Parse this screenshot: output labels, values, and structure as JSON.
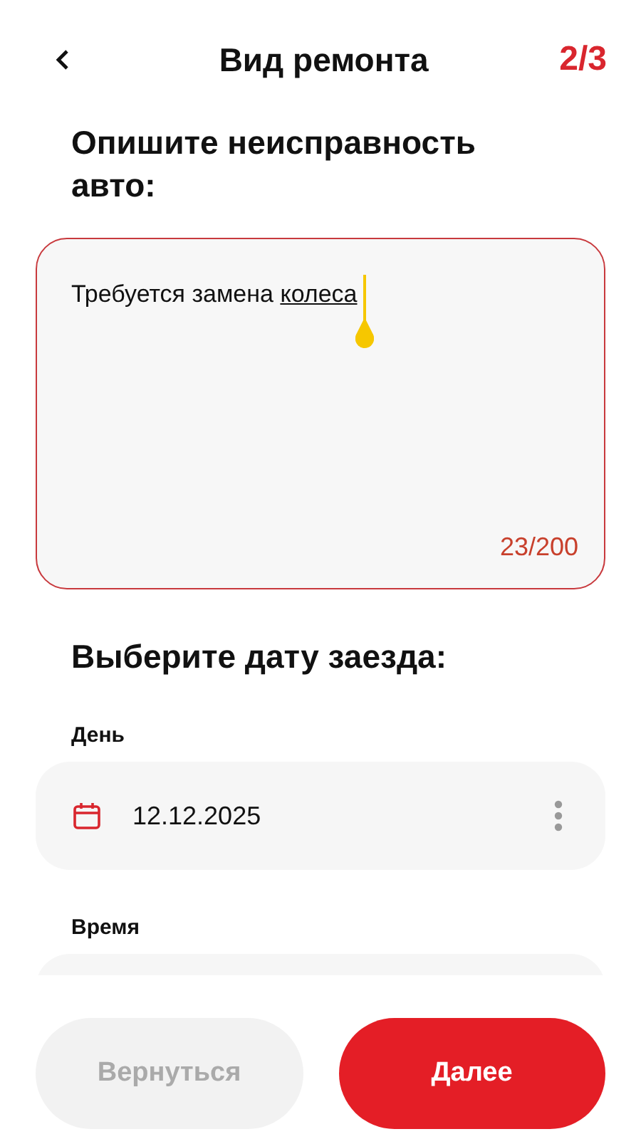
{
  "header": {
    "title": "Вид ремонта",
    "step": "2/3"
  },
  "description": {
    "heading": "Опишите неисправность авто:",
    "text": "Требуется замена ",
    "composing_word": "колеса",
    "focused": true,
    "counter": "23/200"
  },
  "date_section": {
    "heading": "Выберите дату заезда:",
    "fields": [
      {
        "label": "День",
        "value": "12.12.2025",
        "kind": "date"
      },
      {
        "label": "Время",
        "kind": "time"
      }
    ]
  },
  "buttons": [
    {
      "label": "Вернуться",
      "disabled": true
    },
    {
      "label": "Далее",
      "disabled": false
    }
  ]
}
